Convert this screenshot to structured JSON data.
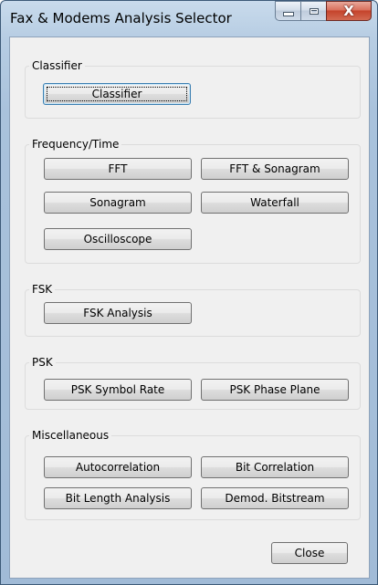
{
  "window": {
    "title": "Fax & Modems Analysis Selector",
    "caption_buttons": {
      "minimize_icon": "minimize-icon",
      "maximize_icon": "maximize-icon",
      "close_glyph": "X"
    }
  },
  "groups": {
    "classifier": {
      "label": "Classifier",
      "buttons": {
        "classifier": "Classifier"
      }
    },
    "frequency_time": {
      "label": "Frequency/Time",
      "buttons": {
        "fft": "FFT",
        "fft_sonagram": "FFT & Sonagram",
        "sonagram": "Sonagram",
        "waterfall": "Waterfall",
        "oscilloscope": "Oscilloscope"
      }
    },
    "fsk": {
      "label": "FSK",
      "buttons": {
        "fsk_analysis": "FSK Analysis"
      }
    },
    "psk": {
      "label": "PSK",
      "buttons": {
        "psk_symbol_rate": "PSK Symbol Rate",
        "psk_phase_plane": "PSK Phase Plane"
      }
    },
    "miscellaneous": {
      "label": "Miscellaneous",
      "buttons": {
        "autocorrelation": "Autocorrelation",
        "bit_correlation": "Bit Correlation",
        "bit_length_analysis": "Bit Length Analysis",
        "demod_bitstream": "Demod. Bitstream"
      }
    }
  },
  "footer": {
    "close": "Close"
  },
  "colors": {
    "frame": "#b7cde3",
    "client": "#f0f0f0",
    "close_button": "#c5432b",
    "focus_border": "#3c7fb1"
  }
}
